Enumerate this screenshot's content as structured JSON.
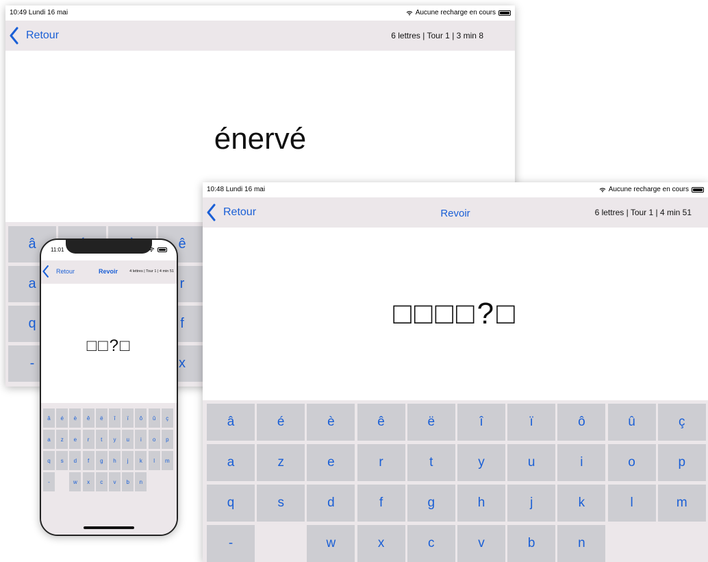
{
  "keyboard": {
    "rows": [
      [
        "â",
        "é",
        "è",
        "ê",
        "ë",
        "î",
        "ï",
        "ô",
        "û",
        "ç"
      ],
      [
        "a",
        "z",
        "e",
        "r",
        "t",
        "y",
        "u",
        "i",
        "o",
        "p"
      ],
      [
        "q",
        "s",
        "d",
        "f",
        "g",
        "h",
        "j",
        "k",
        "l",
        "m"
      ],
      [
        "-",
        "",
        "w",
        "x",
        "c",
        "v",
        "b",
        "n",
        "",
        ""
      ]
    ]
  },
  "screens": {
    "top_ipad": {
      "status_time": "10:49  Lundi 16 mai",
      "status_right": "Aucune recharge en cours",
      "back_label": "Retour",
      "info": "6 lettres | Tour 1 | 3 min 8",
      "word": "énervé"
    },
    "front_ipad": {
      "status_time": "10:48  Lundi 16 mai",
      "status_right": "Aucune recharge en cours",
      "back_label": "Retour",
      "title": "Revoir",
      "info": "6 lettres | Tour 1 | 4 min 51",
      "word_mask": "□□□□?□"
    },
    "iphone": {
      "status_time": "11:01",
      "back_label": "Retour",
      "title": "Revoir",
      "info": "4 lettres | Tour 1 | 4 min 51",
      "word_mask": "□□?□"
    }
  },
  "colors": {
    "accent": "#1a5fd6",
    "navbar_bg": "#ece7ea",
    "key_bg": "#cdcdd2"
  },
  "icons": {
    "back": "chevron-left-icon",
    "wifi": "wifi-icon",
    "battery": "battery-icon"
  }
}
